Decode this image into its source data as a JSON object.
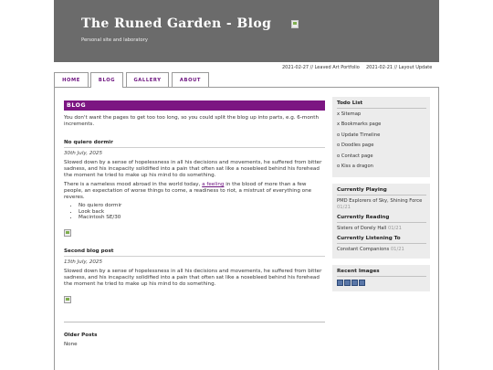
{
  "header": {
    "title": "The Runed Garden - Blog",
    "subtitle": "Personal site and laboratory"
  },
  "updates": [
    {
      "text": "2021-02-27 // Leaved Art Portfolio"
    },
    {
      "text": "2021-02-21 // Layout Update"
    }
  ],
  "tabs": [
    {
      "label": "Home",
      "active": false
    },
    {
      "label": "Blog",
      "active": true
    },
    {
      "label": "Gallery",
      "active": false
    },
    {
      "label": "About",
      "active": false
    }
  ],
  "main": {
    "section_title": "Blog",
    "intro": "You don't want the pages to get too too long, so you could split the blog up into parts, e.g. 6-month increments.",
    "posts": [
      {
        "title": "No quiero dormir",
        "date": "30th July, 2025",
        "para1": "Slowed down by a sense of hopelessness in all his decisions and movements, he suffered from bitter sadness, and his incapacity solidified into a pain that often sat like a nosebleed behind his forehead the moment he tried to make up his mind to do something.",
        "para2_before": "There is a nameless mood abroad in the world today, ",
        "para2_link": "a feeling",
        "para2_after": " in the blood of more than a few people, an expectation of worse things to come, a readiness to riot, a mistrust of everything one reveres.",
        "list": [
          "No quiero dormir",
          "Look back",
          "Macintosh SE/30"
        ]
      },
      {
        "title": "Second blog post",
        "date": "13th July, 2025",
        "para1": "Slowed down by a sense of hopelessness in all his decisions and movements, he suffered from bitter sadness, and his incapacity solidified into a pain that often sat like a nosebleed behind his forehead the moment he tried to make up his mind to do something."
      }
    ],
    "older_posts": {
      "heading": "Older Posts",
      "value": "None"
    }
  },
  "sidebar": {
    "todo": {
      "title": "Todo List",
      "items": [
        "x Sitemap",
        "x Bookmarks page",
        "o Update Timeline",
        "o Doodles page",
        "o Contact page",
        "o Kiss a dragon"
      ]
    },
    "current": {
      "playing_title": "Currently Playing",
      "playing": "PMD Explorers of Sky, Shining Force",
      "playing_date": "01/21",
      "reading_title": "Currently Reading",
      "reading": "Sisters of Dorely Hall",
      "reading_date": "01/21",
      "listening_title": "Currently Listening To",
      "listening": "Constant Companions",
      "listening_date": "01/21"
    },
    "images": {
      "title": "Recent Images",
      "count": 4
    }
  },
  "colors": {
    "header_bg": "#6b6b6b",
    "accent": "#7c1682",
    "link": "#6e1580",
    "panel_bg": "#ececec"
  }
}
